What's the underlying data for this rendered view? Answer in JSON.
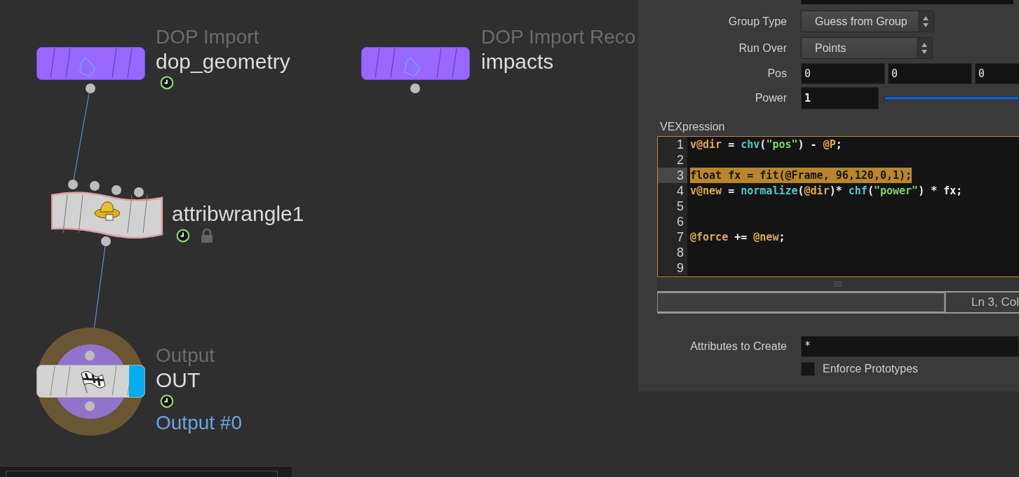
{
  "network": {
    "nodes": [
      {
        "kind": "dop",
        "type_label": "DOP Import",
        "name": "dop_geometry",
        "time_dependent": true,
        "locked": false,
        "display_flag": false
      },
      {
        "kind": "dop",
        "type_label": "DOP Import Reco",
        "name": "impacts",
        "time_dependent": false,
        "locked": false,
        "display_flag": false
      },
      {
        "kind": "wrangle",
        "name": "attribwrangle1",
        "time_dependent": true,
        "locked": true,
        "display_flag": false
      },
      {
        "kind": "output",
        "type_label": "Output",
        "name": "OUT",
        "time_dependent": true,
        "locked": false,
        "display_flag": true,
        "output_label": "Output #0"
      }
    ]
  },
  "parameters": {
    "group_type": {
      "label": "Group Type",
      "value": "Guess from Group"
    },
    "run_over": {
      "label": "Run Over",
      "value": "Points"
    },
    "pos": {
      "label": "Pos",
      "values": [
        "0",
        "0",
        "0"
      ]
    },
    "power": {
      "label": "Power",
      "value": "1"
    },
    "vexpression": {
      "label": "VEXpression",
      "lines": [
        {
          "number": "1",
          "highlighted": false,
          "tokens": [
            {
              "text": "v@dir",
              "kind": "attr"
            },
            {
              "text": " = ",
              "kind": "plain"
            },
            {
              "text": "chv",
              "kind": "func"
            },
            {
              "text": "(",
              "kind": "plain"
            },
            {
              "text": "\"pos\"",
              "kind": "string"
            },
            {
              "text": ") - ",
              "kind": "plain"
            },
            {
              "text": "@P",
              "kind": "attr"
            },
            {
              "text": ";",
              "kind": "plain"
            }
          ]
        },
        {
          "number": "2",
          "highlighted": false
        },
        {
          "number": "3",
          "highlighted": true,
          "tokens": [
            {
              "text": "float fx = fit(@Frame, 96,120,0,1);",
              "kind": "plain"
            }
          ]
        },
        {
          "number": "4",
          "highlighted": false,
          "tokens": [
            {
              "text": "v@new",
              "kind": "attr"
            },
            {
              "text": " = ",
              "kind": "plain"
            },
            {
              "text": "normalize",
              "kind": "func"
            },
            {
              "text": "(",
              "kind": "plain"
            },
            {
              "text": "@dir",
              "kind": "attr"
            },
            {
              "text": ")* ",
              "kind": "plain"
            },
            {
              "text": "chf",
              "kind": "func"
            },
            {
              "text": "(",
              "kind": "plain"
            },
            {
              "text": "\"power\"",
              "kind": "string"
            },
            {
              "text": ") * fx;",
              "kind": "plain"
            }
          ]
        },
        {
          "number": "5",
          "highlighted": false
        },
        {
          "number": "6",
          "highlighted": false
        },
        {
          "number": "7",
          "highlighted": false,
          "tokens": [
            {
              "text": "@force",
              "kind": "attr"
            },
            {
              "text": " += ",
              "kind": "plain"
            },
            {
              "text": "@new",
              "kind": "attr"
            },
            {
              "text": ";",
              "kind": "plain"
            }
          ]
        },
        {
          "number": "8",
          "highlighted": false
        },
        {
          "number": "9",
          "highlighted": false
        }
      ],
      "cursor_status": "Ln 3, Col"
    },
    "attributes_to_create": {
      "label": "Attributes to Create",
      "value": "*"
    },
    "enforce_prototypes": {
      "label": "Enforce Prototypes",
      "checked": false
    }
  }
}
